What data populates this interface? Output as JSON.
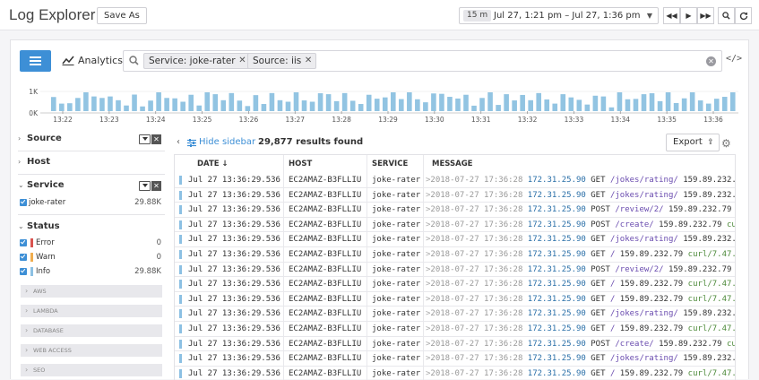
{
  "header": {
    "title": "Log Explorer",
    "save_as_label": "Save As",
    "time_badge": "15 m",
    "time_range": "Jul 27, 1:21 pm – Jul 27, 1:36 pm"
  },
  "toolbar": {
    "analytics_label": "Analytics",
    "tags": [
      {
        "label": "Service: joke-rater"
      },
      {
        "label": "Source: iis"
      }
    ],
    "code_label": "</>"
  },
  "histogram": {
    "y_ticks": [
      "1K",
      "0K"
    ],
    "y_max": 1000,
    "x_ticks": [
      "13:22",
      "13:23",
      "13:24",
      "13:25",
      "13:26",
      "13:27",
      "13:28",
      "13:29",
      "13:30",
      "13:31",
      "13:32",
      "13:33",
      "13:34",
      "13:35",
      "13:36"
    ],
    "values": [
      750,
      400,
      420,
      700,
      1000,
      780,
      700,
      780,
      580,
      300,
      880,
      250,
      560,
      1000,
      700,
      680,
      500,
      870,
      300,
      1000,
      900,
      580,
      960,
      560,
      270,
      850,
      380,
      960,
      580,
      500,
      1000,
      570,
      500,
      950,
      900,
      530,
      960,
      550,
      380,
      870,
      660,
      730,
      1000,
      640,
      1000,
      630,
      470,
      940,
      920,
      760,
      670,
      870,
      290,
      700,
      1000,
      330,
      900,
      570,
      860,
      580,
      960,
      620,
      400,
      900,
      730,
      600,
      350,
      820,
      780,
      200,
      1000,
      630,
      650,
      900,
      950,
      530,
      1000,
      430,
      680,
      1000,
      570,
      400,
      660,
      760,
      1000
    ],
    "bar_color": "#92c4e2"
  },
  "sidebar": {
    "facets": [
      {
        "name": "Source",
        "expanded": false,
        "has_filter": true
      },
      {
        "name": "Host",
        "expanded": false,
        "has_filter": false
      },
      {
        "name": "Service",
        "expanded": true,
        "has_filter": true
      }
    ],
    "service_values": [
      {
        "label": "joke-rater",
        "count": "29.88K"
      }
    ],
    "status_facet": {
      "name": "Status"
    },
    "status_values": [
      {
        "label": "Error",
        "count": "0",
        "color": "#d9534f"
      },
      {
        "label": "Warn",
        "count": "0",
        "color": "#f0ad4e"
      },
      {
        "label": "Info",
        "count": "29.88K",
        "color": "#8cc0e3"
      }
    ],
    "collapsed_groups": [
      "AWS",
      "LAMBDA",
      "DATABASE",
      "WEB ACCESS",
      "SEO"
    ]
  },
  "results": {
    "hide_sidebar_label": "Hide sidebar",
    "count_text": "29,877 results found",
    "export_label": "Export"
  },
  "table": {
    "headers": {
      "date": "DATE ↓",
      "host": "HOST",
      "service": "SERVICE",
      "message": "MESSAGE"
    },
    "rows": [
      {
        "date": "Jul 27 13:36:29.536",
        "host": "EC2AMAZ-B3FLLIU",
        "service": "joke-rater",
        "msg_time": "2018-07-27 17:36:28",
        "msg_ip": "172.31.25.90",
        "msg_verb": "GET",
        "msg_path": "/jokes/rating/",
        "msg_ip2": "159.89.232.",
        "msg_agent": ""
      },
      {
        "date": "Jul 27 13:36:29.536",
        "host": "EC2AMAZ-B3FLLIU",
        "service": "joke-rater",
        "msg_time": "2018-07-27 17:36:28",
        "msg_ip": "172.31.25.90",
        "msg_verb": "GET",
        "msg_path": "/jokes/rating/",
        "msg_ip2": "159.89.232.",
        "msg_agent": ""
      },
      {
        "date": "Jul 27 13:36:29.536",
        "host": "EC2AMAZ-B3FLLIU",
        "service": "joke-rater",
        "msg_time": "2018-07-27 17:36:28",
        "msg_ip": "172.31.25.90",
        "msg_verb": "POST",
        "msg_path": "/review/2/",
        "msg_ip2": "159.89.232.79",
        "msg_agent": "cu"
      },
      {
        "date": "Jul 27 13:36:29.536",
        "host": "EC2AMAZ-B3FLLIU",
        "service": "joke-rater",
        "msg_time": "2018-07-27 17:36:28",
        "msg_ip": "172.31.25.90",
        "msg_verb": "POST",
        "msg_path": "/create/",
        "msg_ip2": "159.89.232.79",
        "msg_agent": "curl/"
      },
      {
        "date": "Jul 27 13:36:29.536",
        "host": "EC2AMAZ-B3FLLIU",
        "service": "joke-rater",
        "msg_time": "2018-07-27 17:36:28",
        "msg_ip": "172.31.25.90",
        "msg_verb": "GET",
        "msg_path": "/jokes/rating/",
        "msg_ip2": "159.89.232.",
        "msg_agent": ""
      },
      {
        "date": "Jul 27 13:36:29.536",
        "host": "EC2AMAZ-B3FLLIU",
        "service": "joke-rater",
        "msg_time": "2018-07-27 17:36:28",
        "msg_ip": "172.31.25.90",
        "msg_verb": "GET",
        "msg_path": "/",
        "msg_ip2": "159.89.232.79",
        "msg_agent": "curl/7.47."
      },
      {
        "date": "Jul 27 13:36:29.536",
        "host": "EC2AMAZ-B3FLLIU",
        "service": "joke-rater",
        "msg_time": "2018-07-27 17:36:28",
        "msg_ip": "172.31.25.90",
        "msg_verb": "POST",
        "msg_path": "/review/2/",
        "msg_ip2": "159.89.232.79",
        "msg_agent": "cu"
      },
      {
        "date": "Jul 27 13:36:29.536",
        "host": "EC2AMAZ-B3FLLIU",
        "service": "joke-rater",
        "msg_time": "2018-07-27 17:36:28",
        "msg_ip": "172.31.25.90",
        "msg_verb": "GET",
        "msg_path": "/",
        "msg_ip2": "159.89.232.79",
        "msg_agent": "curl/7.47."
      },
      {
        "date": "Jul 27 13:36:29.536",
        "host": "EC2AMAZ-B3FLLIU",
        "service": "joke-rater",
        "msg_time": "2018-07-27 17:36:28",
        "msg_ip": "172.31.25.90",
        "msg_verb": "GET",
        "msg_path": "/",
        "msg_ip2": "159.89.232.79",
        "msg_agent": "curl/7.47."
      },
      {
        "date": "Jul 27 13:36:29.536",
        "host": "EC2AMAZ-B3FLLIU",
        "service": "joke-rater",
        "msg_time": "2018-07-27 17:36:28",
        "msg_ip": "172.31.25.90",
        "msg_verb": "GET",
        "msg_path": "/jokes/rating/",
        "msg_ip2": "159.89.232.",
        "msg_agent": ""
      },
      {
        "date": "Jul 27 13:36:29.536",
        "host": "EC2AMAZ-B3FLLIU",
        "service": "joke-rater",
        "msg_time": "2018-07-27 17:36:28",
        "msg_ip": "172.31.25.90",
        "msg_verb": "GET",
        "msg_path": "/",
        "msg_ip2": "159.89.232.79",
        "msg_agent": "curl/7.47."
      },
      {
        "date": "Jul 27 13:36:29.536",
        "host": "EC2AMAZ-B3FLLIU",
        "service": "joke-rater",
        "msg_time": "2018-07-27 17:36:28",
        "msg_ip": "172.31.25.90",
        "msg_verb": "POST",
        "msg_path": "/create/",
        "msg_ip2": "159.89.232.79",
        "msg_agent": "curl/"
      },
      {
        "date": "Jul 27 13:36:29.536",
        "host": "EC2AMAZ-B3FLLIU",
        "service": "joke-rater",
        "msg_time": "2018-07-27 17:36:28",
        "msg_ip": "172.31.25.90",
        "msg_verb": "GET",
        "msg_path": "/jokes/rating/",
        "msg_ip2": "159.89.232.",
        "msg_agent": ""
      },
      {
        "date": "Jul 27 13:36:29.536",
        "host": "EC2AMAZ-B3FLLIU",
        "service": "joke-rater",
        "msg_time": "2018-07-27 17:36:28",
        "msg_ip": "172.31.25.90",
        "msg_verb": "GET",
        "msg_path": "/",
        "msg_ip2": "159.89.232.79",
        "msg_agent": "curl/7.47."
      }
    ]
  }
}
